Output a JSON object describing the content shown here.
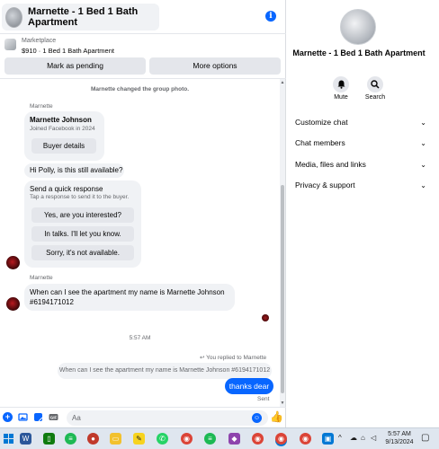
{
  "header": {
    "title": "Marnette - 1 Bed 1 Bath Apartment",
    "info_glyph": "i"
  },
  "listing": {
    "source": "Marketplace",
    "price_title": "$910 · 1 Bed 1 Bath Apartment",
    "mark_pending_label": "Mark as pending",
    "more_options_label": "More options"
  },
  "messages": {
    "system_note": "Marnette changed the group photo.",
    "sender_name_1": "Marnette",
    "profile_card": {
      "name": "Marnette Johnson",
      "joined": "Joined Facebook in 2024",
      "button_label": "Buyer details"
    },
    "buyer_question": "Hi Polly, is this still available?",
    "quick_response": {
      "title": "Send a quick response",
      "subtitle": "Tap a response to send it to the buyer.",
      "options": [
        "Yes, are you interested?",
        "In talks. I'll let you know.",
        "Sorry, it's not available."
      ]
    },
    "sender_name_2": "Marnette",
    "buyer_message_line1": "When can I see the apartment my name is Marnette Johnson",
    "buyer_message_line2": "#6194171012",
    "time_separator": "5:57 AM",
    "replied_note": "You replied to Marnette",
    "quoted_text": "When can I see the apartment my name is Marnette Johnson #6194171012",
    "own_reply": "thanks dear",
    "sent_status": "Sent"
  },
  "composer": {
    "placeholder": "Aa",
    "value": ""
  },
  "details": {
    "title": "Marnette - 1 Bed 1 Bath Apartment",
    "actions": [
      {
        "label": "Mute",
        "icon": "bell-icon"
      },
      {
        "label": "Search",
        "icon": "search-icon"
      }
    ],
    "menu": [
      {
        "label": "Customize chat"
      },
      {
        "label": "Chat members"
      },
      {
        "label": "Media, files and links"
      },
      {
        "label": "Privacy & support"
      }
    ]
  },
  "taskbar": {
    "time": "5:57 AM",
    "date": "9/13/2024"
  },
  "colors": {
    "accent": "#0866ff",
    "bubble_gray": "#f0f2f5",
    "button_gray": "#e4e6eb",
    "secondary_text": "#65676b"
  }
}
